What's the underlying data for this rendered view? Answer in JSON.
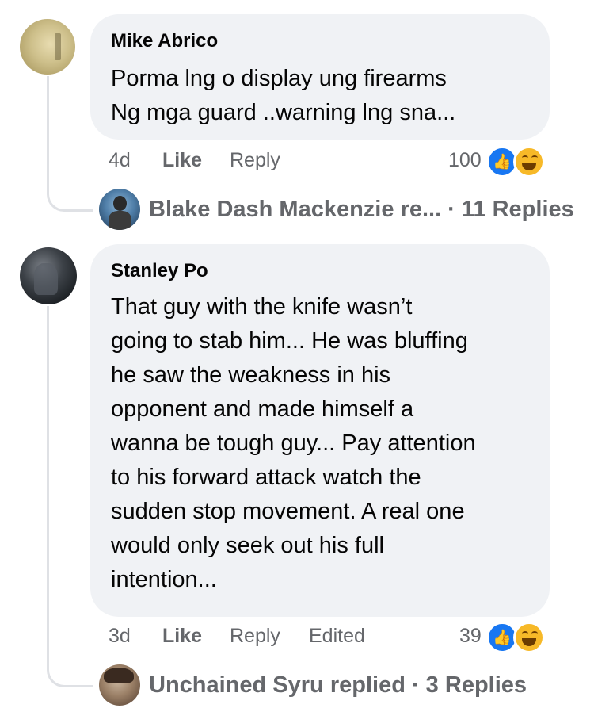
{
  "comments": [
    {
      "author": "Mike Abrico",
      "lines": [
        "Porma lng o display ung firearms",
        "Ng mga guard ..warning lng sna..."
      ],
      "time": "4d",
      "like_label": "Like",
      "reply_label": "Reply",
      "reaction_count": "100",
      "reactions": [
        "like-icon",
        "haha-icon"
      ],
      "replies_summary": "Blake Dash Mackenzie re...  · 11 Replies"
    },
    {
      "author": "Stanley Po",
      "lines": [
        "That guy with the knife wasn’t",
        "going to stab him... He was bluffing",
        "he saw the weakness in his",
        "opponent and made himself a",
        "wanna be tough guy... Pay attention",
        "to his forward attack watch the",
        "sudden stop movement. A real one",
        "would only seek out his full",
        "intention..."
      ],
      "time": "3d",
      "like_label": "Like",
      "reply_label": "Reply",
      "edited_label": "Edited",
      "reaction_count": "39",
      "reactions": [
        "like-icon",
        "haha-icon"
      ],
      "replies_summary": "Unchained Syru replied · 3 Replies"
    }
  ],
  "colors": {
    "bubble": "#f0f2f5",
    "meta_text": "#65676b",
    "like_blue": "#1877f2",
    "haha_yellow": "#f7b928"
  }
}
